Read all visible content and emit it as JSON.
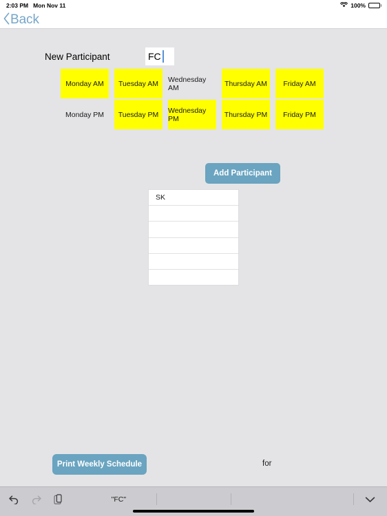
{
  "status_bar": {
    "time": "2:03 PM",
    "date": "Mon Nov 11",
    "battery_percent": "100%",
    "wifi_icon": "wifi-icon",
    "battery_icon": "battery-full-icon"
  },
  "nav_bar": {
    "back_label": "Back",
    "back_chevron_icon": "chevron-left-icon"
  },
  "form": {
    "participant_label": "New Participant",
    "participant_value": "FC",
    "participant_placeholder": ""
  },
  "day_grid": {
    "rows": [
      {
        "period": "AM",
        "cells": [
          {
            "label": "Monday AM",
            "selected": true
          },
          {
            "label": "Tuesday AM",
            "selected": true
          },
          {
            "label": "Wednesday AM",
            "selected": false
          },
          {
            "label": "Thursday AM",
            "selected": true
          },
          {
            "label": "Friday AM",
            "selected": true
          }
        ]
      },
      {
        "period": "PM",
        "cells": [
          {
            "label": "Monday PM",
            "selected": false
          },
          {
            "label": "Tuesday PM",
            "selected": true
          },
          {
            "label": "Wednesday PM",
            "selected": true
          },
          {
            "label": "Thursday PM",
            "selected": true
          },
          {
            "label": "Friday PM",
            "selected": true
          }
        ]
      }
    ],
    "selected_color": "#ffff00"
  },
  "actions": {
    "add_participant_label": "Add Participant",
    "print_schedule_label": "Print Weekly Schedule",
    "for_label": "for",
    "button_color": "#6aa4c0"
  },
  "participant_table": {
    "rows": [
      "SK",
      "",
      "",
      "",
      "",
      ""
    ]
  },
  "accessory_bar": {
    "undo_icon": "undo-arrow-icon",
    "redo_icon": "redo-arrow-icon",
    "paste_icon": "clipboard-paste-icon",
    "predictions": [
      "\"FC\"",
      "",
      ""
    ],
    "dismiss_icon": "chevron-down-icon"
  }
}
